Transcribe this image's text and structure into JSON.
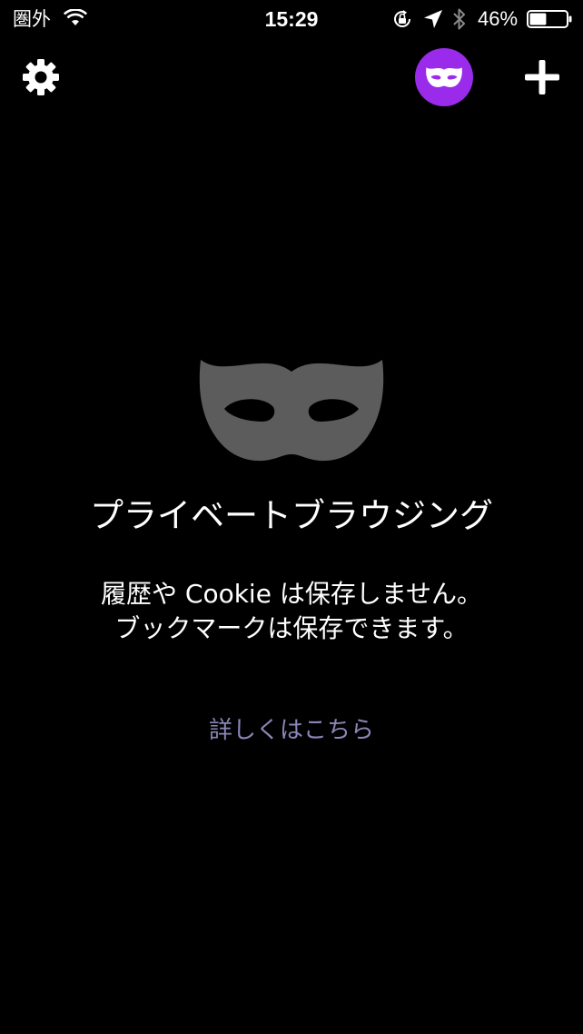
{
  "status_bar": {
    "carrier": "圏外",
    "time": "15:29",
    "battery_percent": "46%",
    "battery_level": 0.46
  },
  "toolbar": {
    "settings_icon": "gear-icon",
    "private_mode_icon": "mask-icon",
    "add_icon": "plus-icon"
  },
  "main": {
    "title": "プライベートブラウジング",
    "description_line1": "履歴や Cookie は保存しません。",
    "description_line2": "ブックマークは保存できます。",
    "learn_more": "詳しくはこちら"
  },
  "colors": {
    "background": "#000000",
    "accent_purple": "#9a2bea",
    "mask_gray": "#5c5c5c",
    "link_color": "#8b86b8",
    "text": "#ffffff"
  }
}
